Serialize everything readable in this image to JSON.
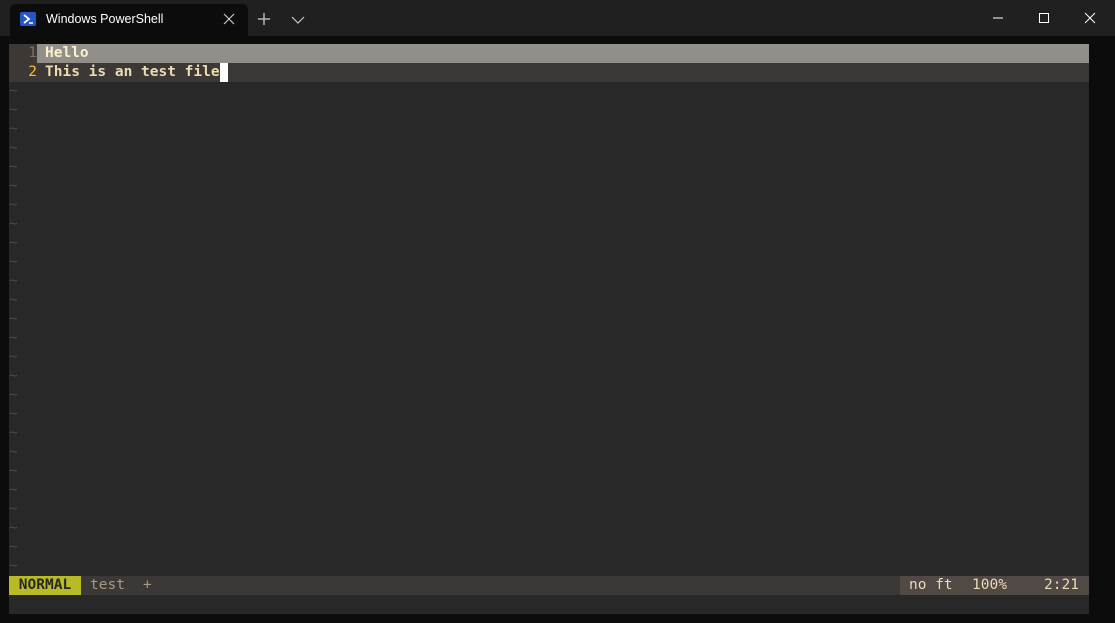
{
  "titlebar": {
    "tab_title": "Windows PowerShell",
    "tab_icon": "powershell-icon",
    "close_tab_icon": "close-icon",
    "new_tab_icon": "plus-icon",
    "dropdown_icon": "chevron-down-icon"
  },
  "window_controls": {
    "minimize_icon": "minimize-icon",
    "maximize_icon": "maximize-icon",
    "close_icon": "close-icon"
  },
  "editor": {
    "lines": [
      {
        "number": "1",
        "text": "Hello"
      },
      {
        "number": "2",
        "text": "This is an test file"
      }
    ],
    "empty_line_marker": "~"
  },
  "statusline": {
    "mode": "NORMAL",
    "filename": "test",
    "modified": "+",
    "filetype": "no ft",
    "percent": "100%",
    "position": "2:21"
  },
  "colors": {
    "terminal_bg": "#282828",
    "mode_bg": "#b8bb26",
    "line_number_current": "#fabd2f"
  }
}
